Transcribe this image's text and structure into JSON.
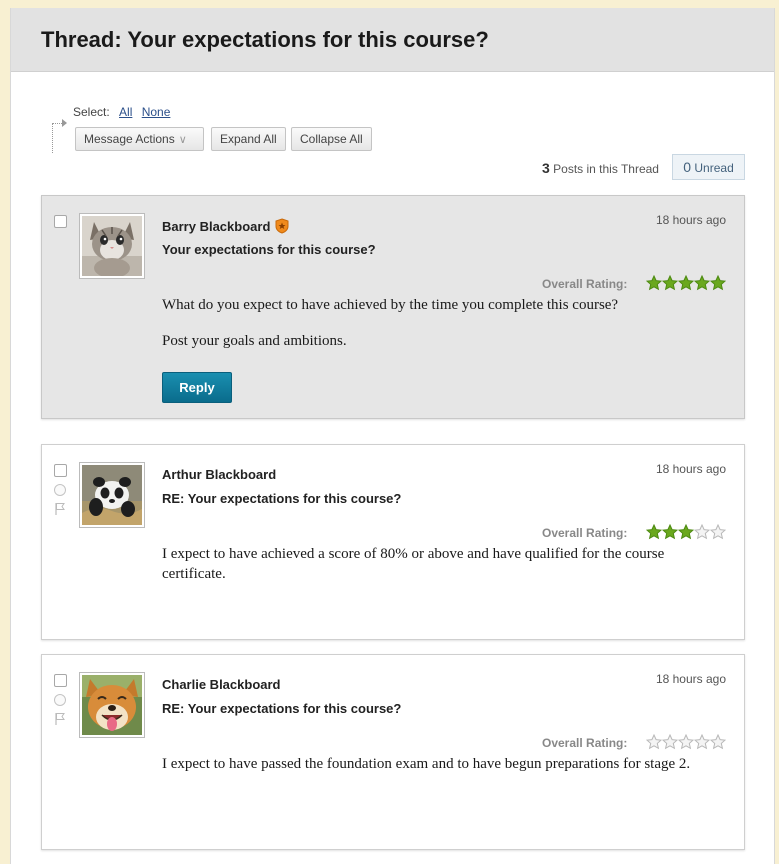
{
  "thread": {
    "title": "Thread: Your expectations for this course?"
  },
  "toolbar": {
    "select_label": "Select:",
    "select_all": "All",
    "select_none": "None",
    "message_actions": "Message Actions",
    "expand_all": "Expand All",
    "collapse_all": "Collapse All"
  },
  "counts": {
    "posts_number": "3",
    "posts_label": "Posts in this Thread",
    "unread_number": "0",
    "unread_label": "Unread"
  },
  "rating_label": "Overall Rating:",
  "colors": {
    "accent_teal": "#0a7a9c",
    "star_green": "#6aa81e",
    "header_gray": "#e2e2e2",
    "page_bg": "#f8f0d2"
  },
  "posts": [
    {
      "author": "Barry Blackboard",
      "author_badge_icon": "star-badge-icon",
      "time": "18 hours ago",
      "subject": "Your expectations for this course?",
      "rating": 5,
      "rating_max": 5,
      "avatar_icon": "cat-avatar-icon",
      "body": [
        "What do you expect to have achieved by the time you complete this course?",
        "Post your goals and ambitions."
      ],
      "reply_label": "Reply"
    },
    {
      "author": "Arthur Blackboard",
      "time": "18 hours ago",
      "subject": "RE: Your expectations for this course?",
      "rating": 3,
      "rating_max": 5,
      "avatar_icon": "panda-avatar-icon",
      "body": [
        "I expect to have achieved a score of 80% or above and have qualified for the course certificate."
      ]
    },
    {
      "author": "Charlie Blackboard",
      "time": "18 hours ago",
      "subject": "RE: Your expectations for this course?",
      "rating": 0,
      "rating_max": 5,
      "avatar_icon": "dog-avatar-icon",
      "body": [
        "I expect to have passed the foundation exam and to have begun preparations for stage 2."
      ]
    }
  ]
}
